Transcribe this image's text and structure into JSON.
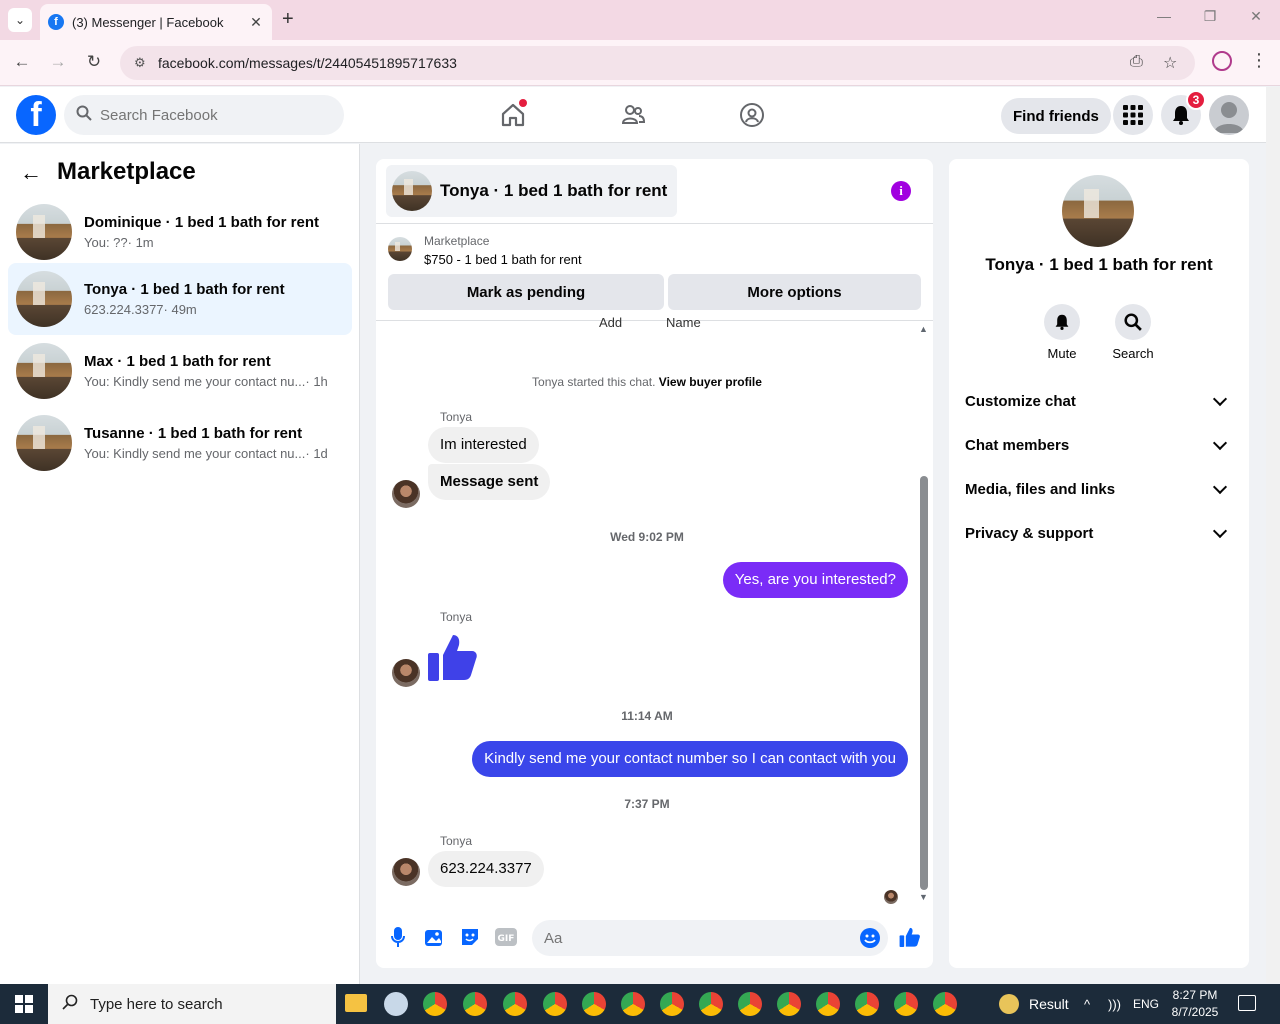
{
  "browser": {
    "tab_title": "(3) Messenger | Facebook",
    "url": "facebook.com/messages/t/24405451895717633",
    "new_tab_symbol": "+",
    "close_symbol": "✕"
  },
  "fb_header": {
    "search_placeholder": "Search Facebook",
    "find_friends_label": "Find friends",
    "notification_count": "3"
  },
  "left": {
    "title": "Marketplace",
    "conversations": [
      {
        "name": "Dominique · 1 bed 1 bath for rent",
        "snippet": "You: ??",
        "time": " · 1m"
      },
      {
        "name": "Tonya · 1 bed 1 bath for rent",
        "snippet": "623.224.3377",
        "time": " · 49m"
      },
      {
        "name": "Max · 1 bed 1 bath for rent",
        "snippet": "You: Kindly send me your contact nu...",
        "time": " · 1h"
      },
      {
        "name": "Tusanne · 1 bed 1 bath for rent",
        "snippet": "You: Kindly send me your contact nu...",
        "time": " · 1d"
      }
    ]
  },
  "chat": {
    "title": "Tonya · 1 bed 1 bath for rent",
    "marketplace_label": "Marketplace",
    "listing": "$750 - 1 bed 1 bath for rent",
    "mark_pending_label": "Mark as pending",
    "more_options_label": "More options",
    "cut_labels": [
      "Add",
      "Name"
    ],
    "started_text": "Tonya started this chat.",
    "view_profile_label": "View buyer profile",
    "sender_name": "Tonya",
    "messages": {
      "m1": "Im interested",
      "m2": "Message sent",
      "ts1": "Wed 9:02 PM",
      "m3": "Yes, are you interested?",
      "ts2": "11:14 AM",
      "m4": "Kindly send me your contact number so I can contact with you",
      "ts3": "7:37 PM",
      "m5": "623.224.3377"
    },
    "composer_placeholder": "Aa"
  },
  "right": {
    "name": "Tonya · 1 bed 1 bath for rent",
    "mute_label": "Mute",
    "search_label": "Search",
    "sections": [
      "Customize chat",
      "Chat members",
      "Media, files and links",
      "Privacy & support"
    ]
  },
  "taskbar": {
    "search_placeholder": "Type here to search",
    "result_label": "Result",
    "language": "ENG",
    "time": "8:27 PM",
    "date": "8/7/2025"
  },
  "colors": {
    "fb_blue": "#0866ff",
    "purple_bubble": "#7a2cf7",
    "blue_bubble": "#3a46ea",
    "badge_red": "#e41e3f"
  }
}
